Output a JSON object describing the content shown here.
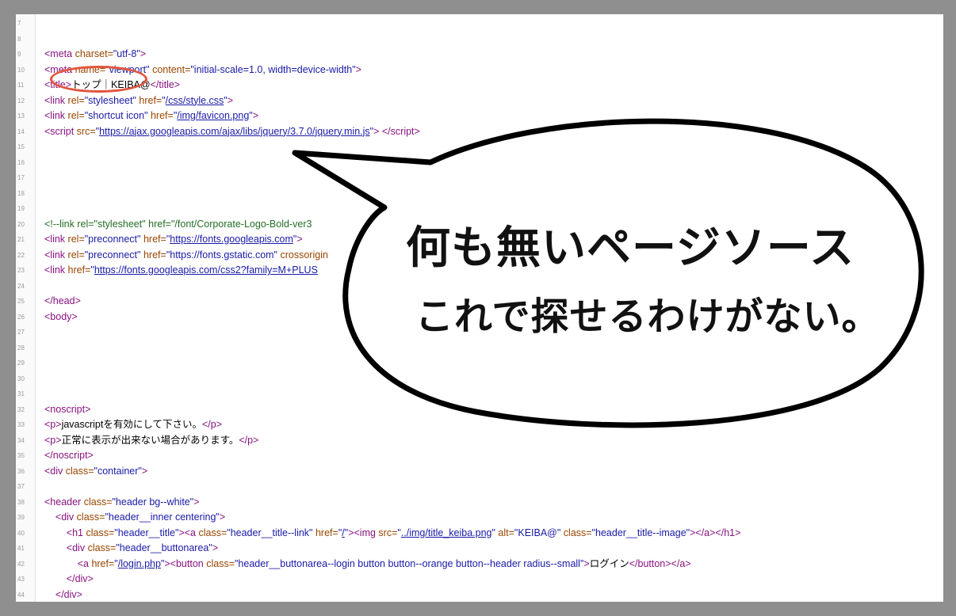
{
  "lines": [
    {
      "n": "7",
      "html": ""
    },
    {
      "n": "8",
      "html": ""
    },
    {
      "n": "9",
      "html": "<span class=\"tg\">&lt;meta</span> <span class=\"an\">charset=</span><span class=\"av\">\"utf-8\"</span><span class=\"tg\">&gt;</span>"
    },
    {
      "n": "10",
      "html": "<span class=\"tg\">&lt;meta</span> <span class=\"an\">name=</span><span class=\"av\">\"viewport\"</span> <span class=\"an\">content=</span><span class=\"av\">\"initial-scale=1.0, width=device-width\"</span><span class=\"tg\">&gt;</span>"
    },
    {
      "n": "11",
      "html": "<span class=\"tg\">&lt;title&gt;</span><span class=\"tx\">トップ｜KEIBA@</span><span class=\"tg\">&lt;/title&gt;</span>"
    },
    {
      "n": "12",
      "html": "<span class=\"tg\">&lt;link</span> <span class=\"an\">rel=</span><span class=\"av\">\"stylesheet\"</span> <span class=\"an\">href=</span><span class=\"av\">\"</span><span class=\"lk\">/css/style.css</span><span class=\"av\">\"</span><span class=\"tg\">&gt;</span>"
    },
    {
      "n": "13",
      "html": "<span class=\"tg\">&lt;link</span> <span class=\"an\">rel=</span><span class=\"av\">\"shortcut icon\"</span> <span class=\"an\">href=</span><span class=\"av\">\"</span><span class=\"lk\">/img/favicon.png</span><span class=\"av\">\"</span><span class=\"tg\">&gt;</span>"
    },
    {
      "n": "14",
      "html": "<span class=\"tg\">&lt;script</span> <span class=\"an\">src=</span><span class=\"av\">\"</span><span class=\"lk\">https://ajax.googleapis.com/ajax/libs/jquery/3.7.0/jquery.min.js</span><span class=\"av\">\"</span><span class=\"tg\">&gt; &lt;/script&gt;</span>"
    },
    {
      "n": "15",
      "html": ""
    },
    {
      "n": "16",
      "html": ""
    },
    {
      "n": "17",
      "html": ""
    },
    {
      "n": "18",
      "html": ""
    },
    {
      "n": "19",
      "html": ""
    },
    {
      "n": "20",
      "html": "<span class=\"cm\">&lt;!--link rel=\"stylesheet\" href=\"/font/Corporate-Logo-Bold-ver3</span>"
    },
    {
      "n": "21",
      "html": "<span class=\"tg\">&lt;link</span> <span class=\"an\">rel=</span><span class=\"av\">\"preconnect\"</span> <span class=\"an\">href=</span><span class=\"av\">\"</span><span class=\"lk\">https://fonts.googleapis.com</span><span class=\"av\">\"</span><span class=\"tg\">&gt;</span>"
    },
    {
      "n": "22",
      "html": "<span class=\"tg\">&lt;link</span> <span class=\"an\">rel=</span><span class=\"av\">\"preconnect\"</span> <span class=\"an\">href=</span><span class=\"av\">\"https://fonts.gstatic.com\"</span> <span class=\"an\">crossorigin</span>"
    },
    {
      "n": "23",
      "html": "<span class=\"tg\">&lt;link</span> <span class=\"an\">href=</span><span class=\"av\">\"</span><span class=\"lk\">https://fonts.googleapis.com/css2?family=M+PLUS</span>"
    },
    {
      "n": "24",
      "html": ""
    },
    {
      "n": "25",
      "html": "<span class=\"tg\">&lt;/head&gt;</span>"
    },
    {
      "n": "26",
      "html": "<span class=\"tg\">&lt;body&gt;</span>"
    },
    {
      "n": "27",
      "html": ""
    },
    {
      "n": "28",
      "html": ""
    },
    {
      "n": "29",
      "html": ""
    },
    {
      "n": "30",
      "html": ""
    },
    {
      "n": "31",
      "html": ""
    },
    {
      "n": "32",
      "html": "<span class=\"tg\">&lt;noscript&gt;</span>"
    },
    {
      "n": "33",
      "html": "<span class=\"tg\">&lt;p&gt;</span><span class=\"tx\">javascriptを有効にして下さい。</span><span class=\"tg\">&lt;/p&gt;</span>"
    },
    {
      "n": "34",
      "html": "<span class=\"tg\">&lt;p&gt;</span><span class=\"tx\">正常に表示が出来ない場合があります。</span><span class=\"tg\">&lt;/p&gt;</span>"
    },
    {
      "n": "35",
      "html": "<span class=\"tg\">&lt;/noscript&gt;</span>"
    },
    {
      "n": "36",
      "html": "<span class=\"tg\">&lt;div</span> <span class=\"an\">class=</span><span class=\"av\">\"container\"</span><span class=\"tg\">&gt;</span>"
    },
    {
      "n": "37",
      "html": ""
    },
    {
      "n": "38",
      "html": "<span class=\"tg\">&lt;header</span> <span class=\"an\">class=</span><span class=\"av\">\"header bg--white\"</span><span class=\"tg\">&gt;</span>"
    },
    {
      "n": "39",
      "html": "    <span class=\"tg\">&lt;div</span> <span class=\"an\">class=</span><span class=\"av\">\"header__inner centering\"</span><span class=\"tg\">&gt;</span>"
    },
    {
      "n": "40",
      "html": "        <span class=\"tg\">&lt;h1</span> <span class=\"an\">class=</span><span class=\"av\">\"header__title\"</span><span class=\"tg\">&gt;&lt;a</span> <span class=\"an\">class=</span><span class=\"av\">\"header__title--link\"</span> <span class=\"an\">href=</span><span class=\"av\">\"</span><span class=\"lk\">/</span><span class=\"av\">\"</span><span class=\"tg\">&gt;&lt;img</span> <span class=\"an\">src=</span><span class=\"av\">\"</span><span class=\"lk\">../img/title_keiba.png</span><span class=\"av\">\"</span> <span class=\"an\">alt=</span><span class=\"av\">\"KEIBA@\"</span> <span class=\"an\">class=</span><span class=\"av\">\"header__title--image\"</span><span class=\"tg\">&gt;&lt;/a&gt;&lt;/h1&gt;</span>"
    },
    {
      "n": "41",
      "html": "        <span class=\"tg\">&lt;div</span> <span class=\"an\">class=</span><span class=\"av\">\"header__buttonarea\"</span><span class=\"tg\">&gt;</span>"
    },
    {
      "n": "42",
      "html": "            <span class=\"tg\">&lt;a</span> <span class=\"an\">href=</span><span class=\"av\">\"</span><span class=\"lk\">/login.php</span><span class=\"av\">\"</span><span class=\"tg\">&gt;&lt;button</span> <span class=\"an\">class=</span><span class=\"av\">\"header__buttonarea--login button button--orange button--header radius--small\"</span><span class=\"tg\">&gt;</span><span class=\"tx\">ログイン</span><span class=\"tg\">&lt;/button&gt;&lt;/a&gt;</span>"
    },
    {
      "n": "43",
      "html": "        <span class=\"tg\">&lt;/div&gt;</span>"
    },
    {
      "n": "44",
      "html": "    <span class=\"tg\">&lt;/div&gt;</span>"
    }
  ],
  "bubble": {
    "line1": "何も無いページソース",
    "line2": "これで探せるわけがない。"
  },
  "colors": {
    "tag": "#881280",
    "attr_name": "#994500",
    "attr_value": "#1a1aa6",
    "highlight_circle": "#e2553d"
  }
}
